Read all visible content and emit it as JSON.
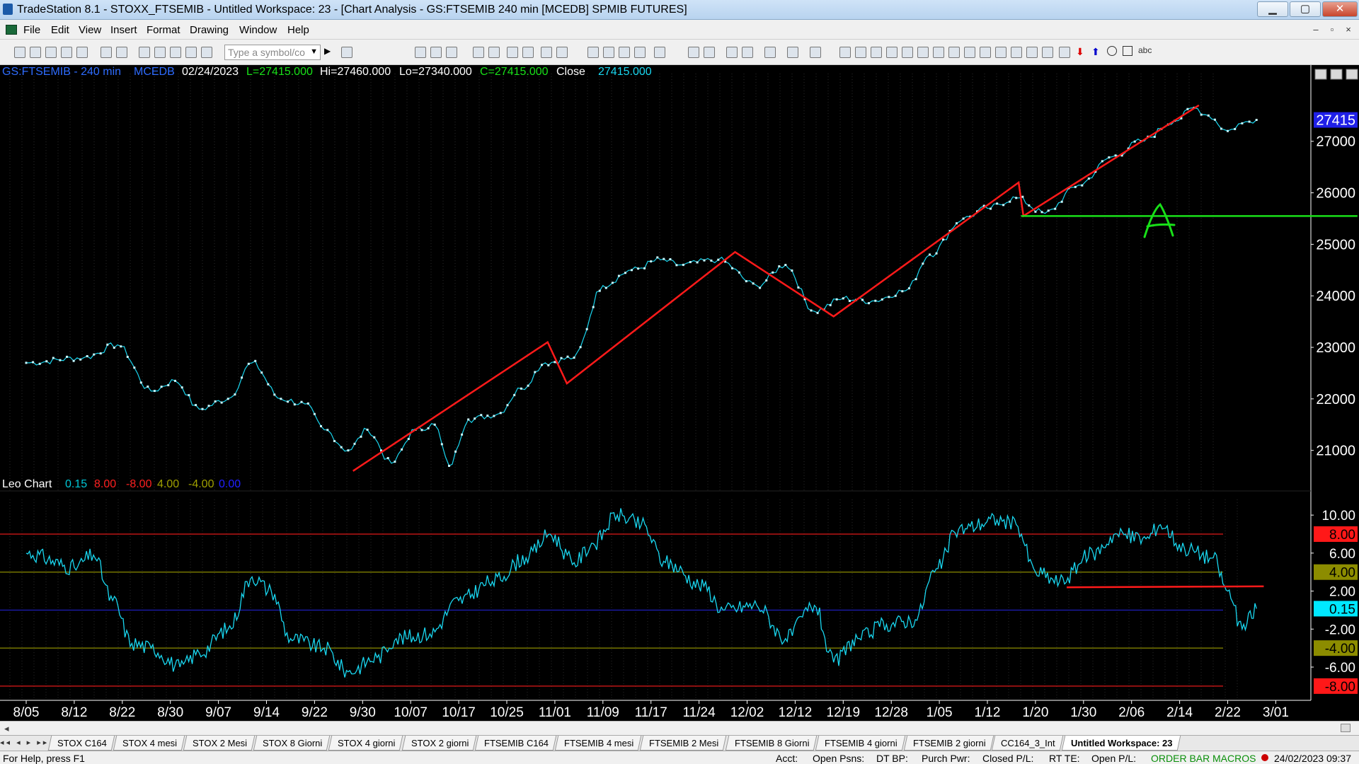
{
  "window": {
    "title": "TradeStation 8.1 - STOXX_FTSEMIB - Untitled Workspace:  23 - [Chart Analysis - GS:FTSEMIB  240 min  [MCEDB] SPMIB FUTURES]",
    "minimize": "▁",
    "maximize": "▢",
    "close": "✕"
  },
  "menu": {
    "items": [
      "File",
      "Edit",
      "View",
      "Insert",
      "Format",
      "Drawing",
      "Window",
      "Help"
    ],
    "mdi": [
      "–",
      "▫",
      "×"
    ]
  },
  "toolbar": {
    "symbol_placeholder": "Type a symbol/co"
  },
  "header": {
    "symbol": "GS:FTSEMIB - 240 min",
    "source": "MCEDB",
    "date": "02/24/2023",
    "last": "L=27415.000",
    "hi": "Hi=27460.000",
    "lo": "Lo=27340.000",
    "close_eq": "C=27415.000",
    "close_label": "Close",
    "close_value": "27415.000"
  },
  "indicator_header": {
    "name": "Leo Chart",
    "values": [
      "0.15",
      "8.00",
      "-8.00",
      "4.00",
      "-4.00",
      "0.00"
    ],
    "colors": [
      "#00c8d8",
      "#ff2020",
      "#ff2020",
      "#a0a000",
      "#a0a000",
      "#2020ff"
    ]
  },
  "price_axis": {
    "ticks": [
      "27000",
      "26000",
      "25000",
      "24000",
      "23000",
      "22000",
      "21000"
    ],
    "tick_values": [
      27000,
      26000,
      25000,
      24000,
      23000,
      22000,
      21000
    ],
    "last_tag": "27415"
  },
  "osc_axis": {
    "ticks": [
      {
        "v": 10,
        "t": "10.00"
      },
      {
        "v": 6,
        "t": "6.00"
      },
      {
        "v": 2,
        "t": "2.00"
      },
      {
        "v": -2,
        "t": "-2.00"
      },
      {
        "v": -6,
        "t": "-6.00"
      }
    ],
    "tags": [
      {
        "v": 8,
        "t": "8.00",
        "bg": "#ff1818",
        "fg": "#000"
      },
      {
        "v": 4,
        "t": "4.00",
        "bg": "#8c8c00",
        "fg": "#000"
      },
      {
        "v": 0.15,
        "t": "0.15",
        "bg": "#00e8ff",
        "fg": "#000"
      },
      {
        "v": -4,
        "t": "-4.00",
        "bg": "#8c8c00",
        "fg": "#000"
      },
      {
        "v": -8,
        "t": "-8.00",
        "bg": "#ff1818",
        "fg": "#000"
      }
    ]
  },
  "colors": {
    "background": "#000000",
    "price": "#19d7f0",
    "trendline": "#ff1a1a",
    "support": "#18e018",
    "annotation": "#18e018",
    "oscillator": "#19d7f0",
    "axis_text": "#ffffff"
  },
  "annotation_text": "A",
  "chart_data": [
    {
      "type": "line",
      "title": "GS:FTSEMIB - 240 min",
      "x": [
        "8/05",
        "8/12",
        "8/22",
        "8/30",
        "9/07",
        "9/14",
        "9/22",
        "9/30",
        "10/07",
        "10/17",
        "10/25",
        "11/01",
        "11/09",
        "11/17",
        "11/24",
        "12/02",
        "12/12",
        "12/19",
        "12/28",
        "1/05",
        "1/12",
        "1/20",
        "1/30",
        "2/06",
        "2/14",
        "2/22",
        "3/01"
      ],
      "series": [
        {
          "anchors": [
            [
              0,
              22700
            ],
            [
              1.2,
              22800
            ],
            [
              1.9,
              23050
            ],
            [
              2.6,
              22150
            ],
            [
              3.1,
              22350
            ],
            [
              3.6,
              21800
            ],
            [
              4.2,
              22000
            ],
            [
              4.7,
              22700
            ],
            [
              5.3,
              22000
            ],
            [
              5.8,
              21900
            ],
            [
              6.2,
              21400
            ],
            [
              6.7,
              21000
            ],
            [
              7.1,
              21400
            ],
            [
              7.6,
              20750
            ],
            [
              8.1,
              21400
            ],
            [
              8.5,
              21500
            ],
            [
              8.8,
              20700
            ],
            [
              9.2,
              21600
            ],
            [
              9.8,
              21700
            ],
            [
              10.3,
              22200
            ],
            [
              10.8,
              22700
            ],
            [
              11.4,
              22800
            ],
            [
              12.0,
              24200
            ],
            [
              12.6,
              24500
            ],
            [
              13.2,
              24700
            ],
            [
              13.6,
              24600
            ],
            [
              14.4,
              24700
            ],
            [
              15.2,
              24200
            ],
            [
              15.8,
              24600
            ],
            [
              16.4,
              23700
            ],
            [
              17.0,
              23950
            ],
            [
              17.6,
              23900
            ],
            [
              18.3,
              24100
            ],
            [
              18.8,
              24800
            ],
            [
              19.5,
              25500
            ],
            [
              20.0,
              25700
            ],
            [
              20.6,
              25900
            ],
            [
              21.2,
              25600
            ],
            [
              21.9,
              26150
            ],
            [
              22.6,
              26700
            ],
            [
              23.2,
              27000
            ],
            [
              23.9,
              27400
            ],
            [
              24.3,
              27650
            ],
            [
              24.6,
              27500
            ],
            [
              25.0,
              27200
            ],
            [
              25.3,
              27350
            ],
            [
              25.6,
              27415
            ]
          ]
        }
      ],
      "trendlines": [
        [
          [
            6.8,
            20600
          ],
          [
            10.85,
            23100
          ],
          [
            11.25,
            22300
          ],
          [
            14.75,
            24850
          ],
          [
            16.8,
            23600
          ],
          [
            20.65,
            26200
          ],
          [
            20.75,
            25550
          ],
          [
            24.4,
            27700
          ]
        ]
      ],
      "support_line": {
        "y": 25550,
        "x_from": 20.7,
        "x_to": 27.7
      },
      "ylim": [
        20350,
        28150
      ]
    },
    {
      "type": "line",
      "title": "Leo Chart",
      "series": [
        {
          "anchors": [
            [
              0,
              6
            ],
            [
              1.0,
              4.5
            ],
            [
              1.4,
              5.8
            ],
            [
              1.8,
              1
            ],
            [
              2.2,
              -3.5
            ],
            [
              2.6,
              -4
            ],
            [
              3.2,
              -6
            ],
            [
              3.6,
              -4.5
            ],
            [
              4.2,
              -2
            ],
            [
              4.7,
              3.5
            ],
            [
              5.1,
              2
            ],
            [
              5.5,
              -3
            ],
            [
              6.2,
              -4
            ],
            [
              6.7,
              -6.5
            ],
            [
              7.3,
              -5
            ],
            [
              7.7,
              -3
            ],
            [
              8.4,
              -2.5
            ],
            [
              9.0,
              1
            ],
            [
              9.7,
              3
            ],
            [
              10.4,
              5.5
            ],
            [
              10.9,
              8
            ],
            [
              11.4,
              5
            ],
            [
              11.8,
              7
            ],
            [
              12.3,
              10
            ],
            [
              12.8,
              9
            ],
            [
              13.3,
              5
            ],
            [
              14.1,
              2.5
            ],
            [
              14.5,
              0
            ],
            [
              15.2,
              0.5
            ],
            [
              15.8,
              -3
            ],
            [
              16.4,
              0.5
            ],
            [
              16.8,
              -5.5
            ],
            [
              17.3,
              -3
            ],
            [
              17.9,
              -1.5
            ],
            [
              18.5,
              -1
            ],
            [
              18.9,
              4
            ],
            [
              19.4,
              8.5
            ],
            [
              20.2,
              9.5
            ],
            [
              20.6,
              9
            ],
            [
              21.0,
              4
            ],
            [
              21.5,
              3
            ],
            [
              22.2,
              6
            ],
            [
              22.7,
              8
            ],
            [
              23.3,
              7.5
            ],
            [
              23.6,
              9
            ],
            [
              24.1,
              6.5
            ],
            [
              24.7,
              5.5
            ],
            [
              25.0,
              2
            ],
            [
              25.3,
              -2
            ],
            [
              25.6,
              0.15
            ]
          ]
        }
      ],
      "ref_lines": [
        8,
        4,
        0,
        -4,
        -8
      ],
      "trendline": [
        [
          21.65,
          2.4
        ],
        [
          25.75,
          2.5
        ]
      ],
      "ylim": [
        -9.5,
        11.5
      ]
    }
  ],
  "tabs": [
    {
      "label": "STOX C164"
    },
    {
      "label": "STOX 4 mesi"
    },
    {
      "label": "STOX 2 Mesi"
    },
    {
      "label": "STOX 8 Giorni"
    },
    {
      "label": "STOX 4 giorni"
    },
    {
      "label": "STOX 2 giorni"
    },
    {
      "label": "FTSEMIB C164"
    },
    {
      "label": "FTSEMIB 4 mesi"
    },
    {
      "label": "FTSEMIB 2 Mesi"
    },
    {
      "label": "FTSEMIB 8 Giorni"
    },
    {
      "label": "FTSEMIB 4 giorni"
    },
    {
      "label": "FTSEMIB 2 giorni"
    },
    {
      "label": "CC164_3_Int"
    },
    {
      "label": "Untitled Workspace: 23",
      "active": true
    }
  ],
  "tabnav": "◂◂ ◂ ▸ ▸▸",
  "status": {
    "help": "For Help, press F1",
    "acct": "Acct:",
    "open_psns": "Open Psns:",
    "dt_bp": "DT BP:",
    "purch_pwr": "Purch Pwr:",
    "closed_pl": "Closed P/L:",
    "rt_te": "RT TE:",
    "open_pl": "Open P/L:",
    "order_bar": "ORDER BAR",
    "macros": "MACROS",
    "datetime": "24/02/2023 09:37"
  }
}
